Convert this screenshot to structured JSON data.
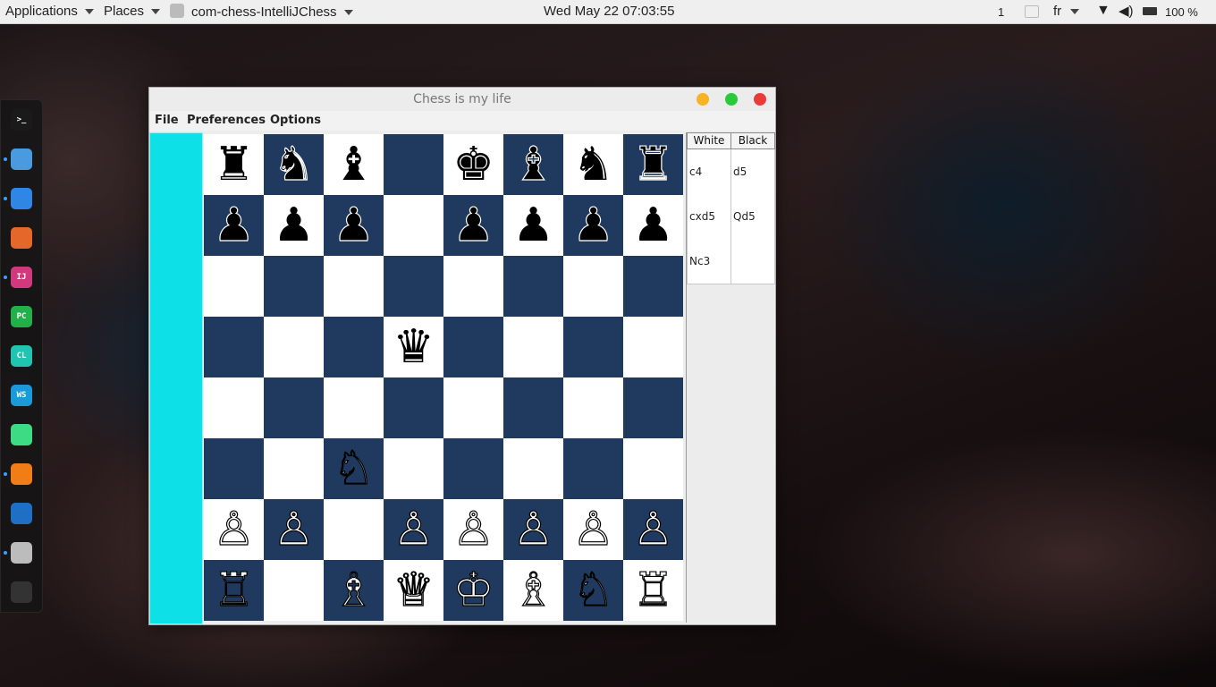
{
  "topbar": {
    "applications": "Applications",
    "places": "Places",
    "app_name": "com-chess-IntelliJChess",
    "datetime": "Wed May 22  07:03:55",
    "workspace": "1",
    "language": "fr",
    "battery": "100 %"
  },
  "dock": {
    "items": [
      {
        "name": "terminal",
        "label": ">_",
        "color": "#1a1a1a"
      },
      {
        "name": "finder",
        "label": "",
        "color": "#4a9ae0"
      },
      {
        "name": "safari",
        "label": "",
        "color": "#2f86e4"
      },
      {
        "name": "firefox",
        "label": "",
        "color": "#e6672a"
      },
      {
        "name": "intellij",
        "label": "IJ",
        "color": "#d03a7d"
      },
      {
        "name": "pycharm",
        "label": "PC",
        "color": "#22b04a"
      },
      {
        "name": "clion",
        "label": "CL",
        "color": "#21c3b1"
      },
      {
        "name": "webstorm",
        "label": "WS",
        "color": "#1b9ad9"
      },
      {
        "name": "android-studio",
        "label": "",
        "color": "#3ddc84"
      },
      {
        "name": "vlc",
        "label": "",
        "color": "#f07d15"
      },
      {
        "name": "vscode",
        "label": "",
        "color": "#1f6fc4"
      },
      {
        "name": "chess",
        "label": "",
        "color": "#bcbcbc"
      },
      {
        "name": "app-grid",
        "label": "",
        "color": "#333333"
      }
    ]
  },
  "window": {
    "title": "Chess is my life",
    "menu": [
      "File",
      "Preferences",
      "Options"
    ],
    "colors": {
      "dark_square": "#1f3a5e",
      "light_square": "#ffffff",
      "side_panel": "#0ee0e8"
    }
  },
  "board": [
    [
      "r",
      "n",
      "b",
      "",
      "k",
      "b",
      "n",
      "r"
    ],
    [
      "p",
      "p",
      "p",
      "",
      "p",
      "p",
      "p",
      "p"
    ],
    [
      "",
      "",
      "",
      "",
      "",
      "",
      "",
      ""
    ],
    [
      "",
      "",
      "",
      "q",
      "",
      "",
      "",
      ""
    ],
    [
      "",
      "",
      "",
      "",
      "",
      "",
      "",
      ""
    ],
    [
      "",
      "",
      "N",
      "",
      "",
      "",
      "",
      ""
    ],
    [
      "P",
      "P",
      "",
      "P",
      "P",
      "P",
      "P",
      "P"
    ],
    [
      "R",
      "",
      "B",
      "Q",
      "K",
      "B",
      "N",
      "R"
    ]
  ],
  "moves": {
    "headers": [
      "White",
      "Black"
    ],
    "rows": [
      [
        "c4",
        "d5"
      ],
      [
        "cxd5",
        "Qd5"
      ],
      [
        "Nc3",
        ""
      ]
    ]
  }
}
